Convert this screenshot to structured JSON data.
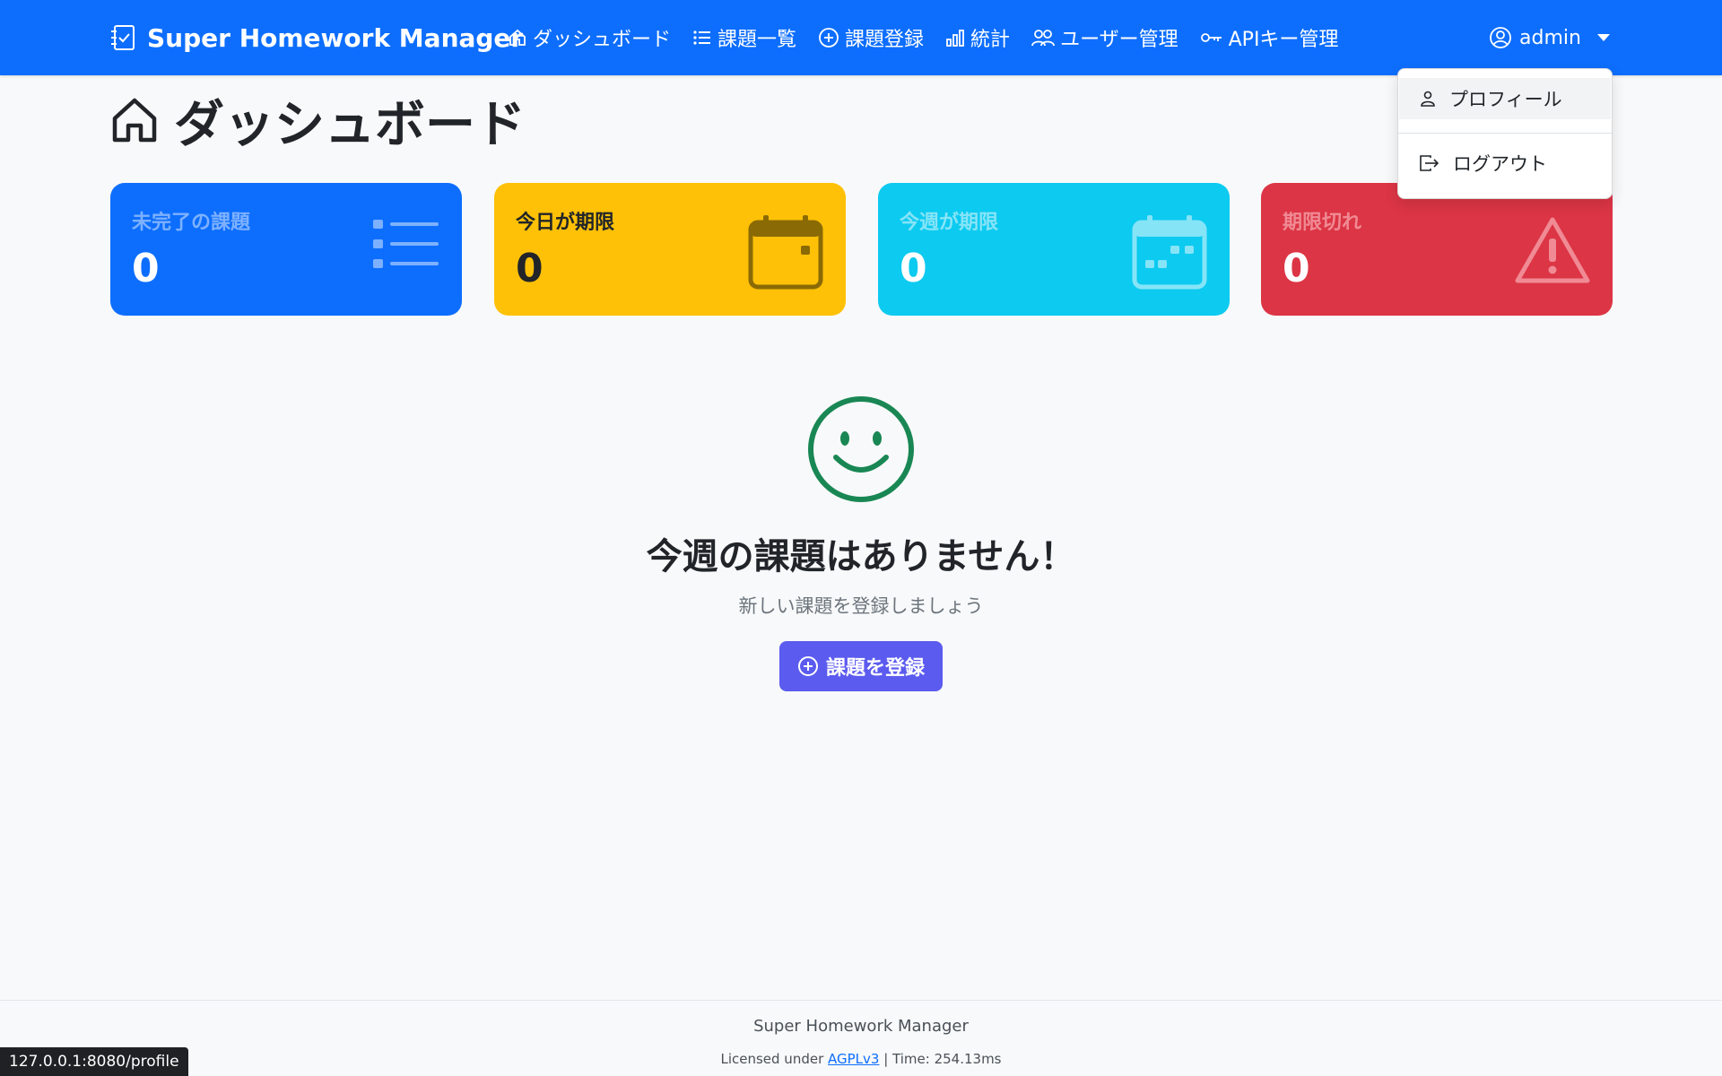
{
  "navbar": {
    "brand": "Super Homework Manager",
    "links": [
      {
        "label": "ダッシュボード",
        "icon": "house-icon"
      },
      {
        "label": "課題一覧",
        "icon": "list-icon"
      },
      {
        "label": "課題登録",
        "icon": "plus-circle-icon"
      },
      {
        "label": "統計",
        "icon": "bar-chart-icon"
      },
      {
        "label": "ユーザー管理",
        "icon": "people-icon"
      },
      {
        "label": "APIキー管理",
        "icon": "key-icon"
      }
    ],
    "user": "admin"
  },
  "dropdown": {
    "items": [
      {
        "label": "プロフィール",
        "icon": "person-icon"
      },
      {
        "label": "ログアウト",
        "icon": "logout-icon"
      }
    ]
  },
  "page": {
    "title": "ダッシュボード"
  },
  "stats": [
    {
      "label": "未完了の課題",
      "value": "0",
      "bg": "#0d6efd",
      "label_color": "#7db1ff",
      "value_color": "#ffffff",
      "icon": "list-icon"
    },
    {
      "label": "今日が期限",
      "value": "0",
      "bg": "#ffc107",
      "label_color": "#212529",
      "value_color": "#212529",
      "icon": "calendar-icon"
    },
    {
      "label": "今週が期限",
      "value": "0",
      "bg": "#0dcaf0",
      "label_color": "#86e4f7",
      "value_color": "#ffffff",
      "icon": "calendar-week-icon"
    },
    {
      "label": "期限切れ",
      "value": "0",
      "bg": "#dc3545",
      "label_color": "#f08a94",
      "value_color": "#ffffff",
      "icon": "warning-icon"
    }
  ],
  "empty": {
    "title": "今週の課題はありません！",
    "subtitle": "新しい課題を登録しましょう",
    "button": "課題を登録"
  },
  "footer": {
    "name": "Super Homework Manager",
    "license_prefix": "Licensed under ",
    "license_link": "AGPLv3",
    "time": " | Time: 254.13ms"
  },
  "statusbar": {
    "url": "127.0.0.1:8080/profile"
  }
}
